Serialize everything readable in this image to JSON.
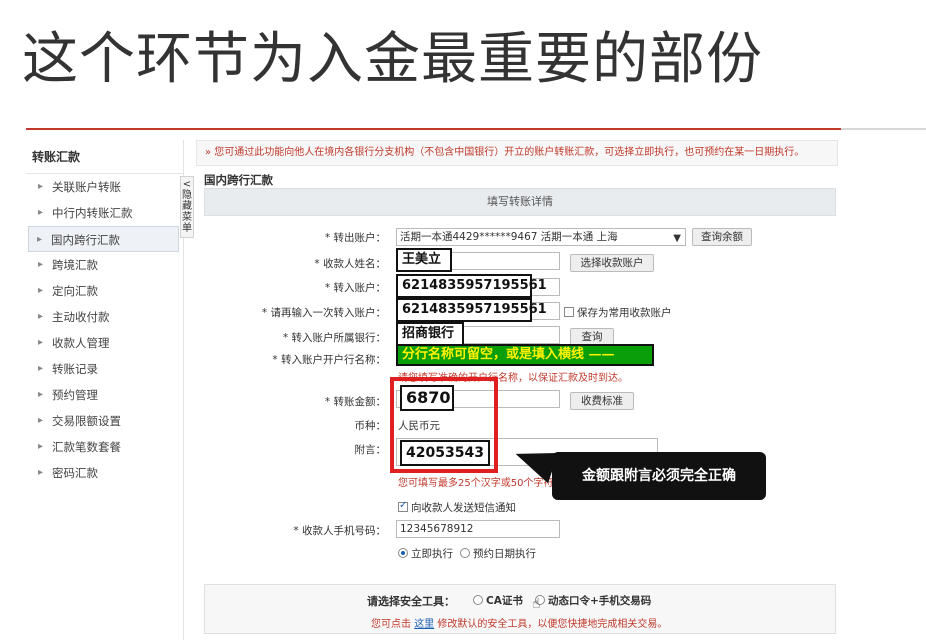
{
  "slide": {
    "title": "这个环节为入金最重要的部份"
  },
  "sidebar": {
    "title": "转账汇款",
    "items": [
      {
        "label": "关联账户转账"
      },
      {
        "label": "中行内转账汇款"
      },
      {
        "label": "国内跨行汇款"
      },
      {
        "label": "跨境汇款"
      },
      {
        "label": "定向汇款"
      },
      {
        "label": "主动收付款"
      },
      {
        "label": "收款人管理"
      },
      {
        "label": "转账记录"
      },
      {
        "label": "预约管理"
      },
      {
        "label": "交易限额设置"
      },
      {
        "label": "汇款笔数套餐"
      },
      {
        "label": "密码汇款"
      }
    ],
    "collapse_label": [
      "<",
      "隐",
      "藏",
      "菜",
      "单"
    ]
  },
  "notice": "» 您可通过此功能向他人在境内各银行分支机构（不包含中国银行）开立的账户转账汇款，可选择立即执行，也可预约在某一日期执行。",
  "section_title": "国内跨行汇款",
  "form_header": "填写转账详情",
  "form": {
    "from_account_label": "* 转出账户：",
    "from_account_value": "活期一本通4429******9467 活期一本通 上海",
    "balance_button": "查询余额",
    "payee_name_label": "* 收款人姓名：",
    "payee_name_value": "王美立",
    "select_payee_button": "选择收款账户",
    "to_account_label": "* 转入账户：",
    "to_account_value": "6214835957195561",
    "confirm_account_label": "* 请再输入一次转入账户：",
    "confirm_account_value": "6214835957195561",
    "save_payee_label": "保存为常用收款账户",
    "bank_label": "* 转入账户所属银行：",
    "bank_value": "招商银行",
    "bank_query_button": "查询",
    "branch_label": "* 转入账户开户行名称：",
    "branch_annotation": "分行名称可留空，或是填入横线 ——",
    "branch_hint": "请您填写准确的开户行名称，以保证汇款及时到达。",
    "amount_label": "* 转账金额：",
    "amount_value": "6870",
    "fee_button": "收费标准",
    "currency_label": "币种：",
    "currency_value": "人民币元",
    "memo_label": "附言：",
    "memo_value": "42053543",
    "memo_hint": "您可填写最多25个汉字或50个字符用",
    "sms_notify_label": "向收款人发送短信通知",
    "phone_label": "* 收款人手机号码：",
    "phone_value": "12345678912",
    "exec_now_label": "立即执行",
    "exec_schedule_label": "预约日期执行"
  },
  "callout": "金额跟附言必须完全正确",
  "security": {
    "label": "请选择安全工具：",
    "option_ca": "CA证书",
    "option_dynamic": "动态口令+手机交易码",
    "hint_prefix": "您可点击",
    "hint_link": "这里",
    "hint_suffix": "修改默认的安全工具，以便您快捷地完成相关交易。"
  },
  "colors": {
    "accent_red": "#e02020",
    "annotation_green": "#0a9e0a",
    "annotation_yellow": "#fff200"
  }
}
